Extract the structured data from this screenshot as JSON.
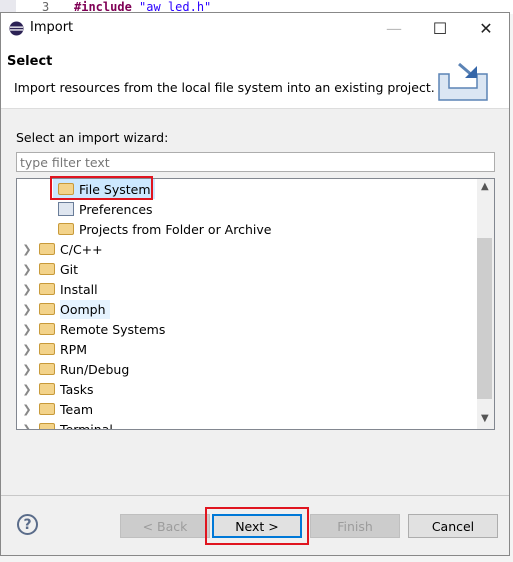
{
  "editor": {
    "line_number": "3",
    "code_keyword": "#include",
    "code_string": "\"aw_led.h\""
  },
  "window": {
    "title": "Import",
    "minimize": "—",
    "maximize": "☐",
    "close": "✕"
  },
  "header": {
    "title": "Select",
    "description": "Import resources from the local file system into an existing project."
  },
  "wizard": {
    "label": "Select an import wizard:",
    "filter_placeholder": "type filter text",
    "filter_value": ""
  },
  "tree": {
    "children": [
      {
        "label": "File System",
        "icon": "folder-icon",
        "selected": true
      },
      {
        "label": "Preferences",
        "icon": "preferences-icon"
      },
      {
        "label": "Projects from Folder or Archive",
        "icon": "folder-icon"
      }
    ],
    "categories": [
      "C/C++",
      "Git",
      "Install",
      "Oomph",
      "Remote Systems",
      "RPM",
      "Run/Debug",
      "Tasks",
      "Team",
      "Terminal"
    ],
    "hovered": "Oomph"
  },
  "buttons": {
    "help": "?",
    "back": "< Back",
    "next": "Next >",
    "finish": "Finish",
    "cancel": "Cancel"
  }
}
